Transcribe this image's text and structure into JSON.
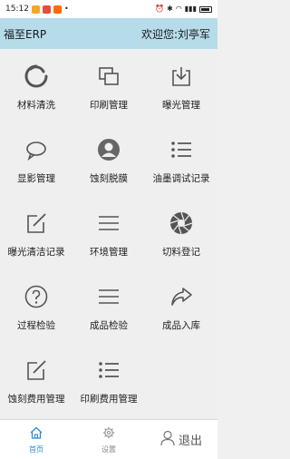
{
  "status_bar": {
    "time": "15:12",
    "icons": [
      "cat-app-icon",
      "mail-app-icon",
      "shop-app-icon",
      "dot-icon",
      "alarm-icon",
      "bluetooth-icon",
      "wifi-icon",
      "signal-icon",
      "battery-icon"
    ]
  },
  "header": {
    "title": "福至ERP",
    "welcome": "欢迎您:刘亭军"
  },
  "menu": [
    {
      "label": "材料清洗",
      "icon": "refresh-icon"
    },
    {
      "label": "印刷管理",
      "icon": "copy-icon"
    },
    {
      "label": "曝光管理",
      "icon": "download-icon"
    },
    {
      "label": "显影管理",
      "icon": "chat-bubble-icon"
    },
    {
      "label": "蚀刻脱膜",
      "icon": "person-icon"
    },
    {
      "label": "油墨调试记录",
      "icon": "list-icon"
    },
    {
      "label": "曝光清洁记录",
      "icon": "edit-icon"
    },
    {
      "label": "环境管理",
      "icon": "menu-icon"
    },
    {
      "label": "切料登记",
      "icon": "aperture-icon"
    },
    {
      "label": "过程检验",
      "icon": "question-icon"
    },
    {
      "label": "成品检验",
      "icon": "menu-icon"
    },
    {
      "label": "成品入库",
      "icon": "share-icon"
    },
    {
      "label": "蚀刻费用管理",
      "icon": "edit-icon"
    },
    {
      "label": "印刷费用管理",
      "icon": "list-icon"
    }
  ],
  "tabbar": {
    "home": "首页",
    "settings": "设置",
    "logout": "退出"
  },
  "colors": {
    "header_bg": "#b6dcea",
    "active_tab": "#2a8cd0",
    "icon_gray": "#555555"
  }
}
